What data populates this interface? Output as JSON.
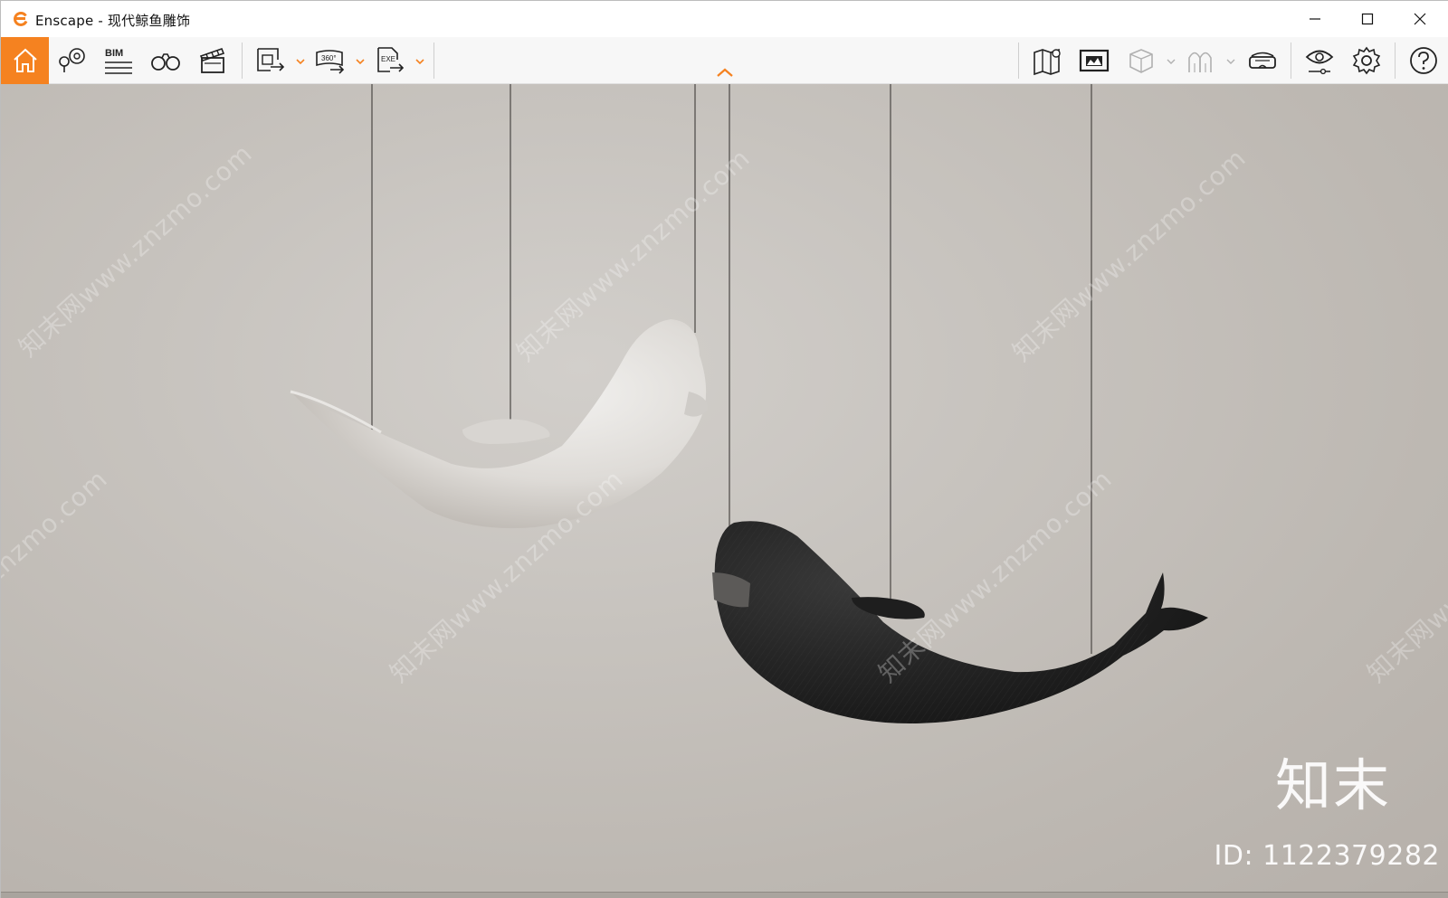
{
  "window": {
    "app_name": "Enscape",
    "title": "Enscape - 现代鲸鱼雕饰",
    "controls": {
      "minimize": "minimize-icon",
      "maximize": "maximize-icon",
      "close": "close-icon"
    }
  },
  "toolbar": {
    "bim_label": "BIM",
    "panorama_label": "360°",
    "exe_label": "EXE",
    "accent_color": "#f58220",
    "items": [
      {
        "icon": "home-icon",
        "active": true
      },
      {
        "icon": "views-icon"
      },
      {
        "icon": "bim-icon"
      },
      {
        "icon": "binoculars-icon"
      },
      {
        "icon": "video-editor-icon"
      },
      {
        "icon": "screenshot-export-icon"
      },
      {
        "icon": "panorama-export-icon"
      },
      {
        "icon": "exe-export-icon"
      },
      {
        "icon": "map-icon"
      },
      {
        "icon": "presentation-icon"
      },
      {
        "icon": "cube-icon",
        "disabled": true
      },
      {
        "icon": "arch-icon",
        "disabled": true
      },
      {
        "icon": "vr-headset-icon"
      },
      {
        "icon": "eye-icon"
      },
      {
        "icon": "gear-icon"
      },
      {
        "icon": "help-icon"
      }
    ]
  },
  "viewport": {
    "scene": "hanging whale sculptures",
    "watermark_text": "知末网www.znzmo.com",
    "brand_mark": "知末",
    "brand_id": "ID: 1122379282"
  }
}
